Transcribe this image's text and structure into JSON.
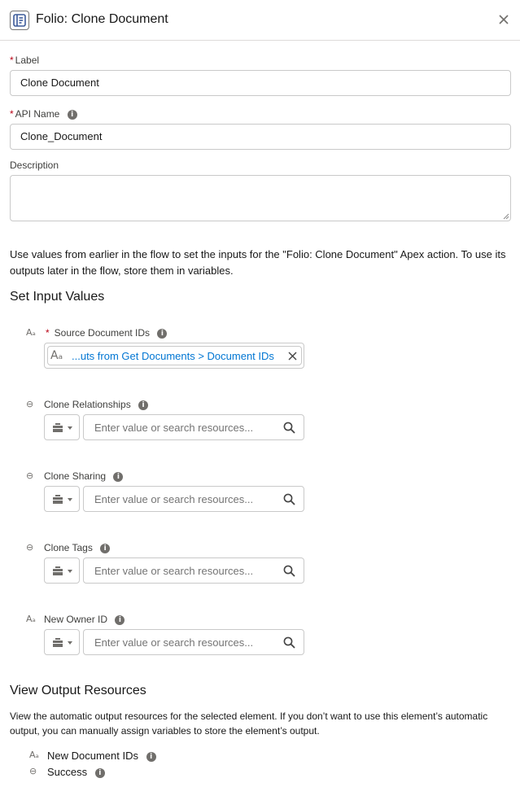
{
  "header": {
    "title": "Folio: Clone Document",
    "icon": "flow-action-icon",
    "close_icon": "close-icon"
  },
  "form": {
    "label": {
      "label": "Label",
      "required": "*",
      "value": "Clone Document"
    },
    "api_name": {
      "label": "API Name",
      "required": "*",
      "value": "Clone_Document"
    },
    "description": {
      "label": "Description",
      "value": ""
    }
  },
  "intro": "Use values from earlier in the flow to set the inputs for the \"Folio: Clone Document\" Apex action. To use its outputs later in the flow, store them in variables.",
  "inputs": {
    "title": "Set Input Values",
    "source_ids": {
      "type_glyph": "Aₐ",
      "required": "*",
      "label": "Source Document IDs",
      "pill_glyph": "Aₐ",
      "pill_text": "...uts from Get Documents > Document IDs"
    },
    "params": [
      {
        "type_glyph": "⊖",
        "label": "Clone Relationships",
        "placeholder": "Enter value or search resources..."
      },
      {
        "type_glyph": "⊖",
        "label": "Clone Sharing",
        "placeholder": "Enter value or search resources..."
      },
      {
        "type_glyph": "⊖",
        "label": "Clone Tags",
        "placeholder": "Enter value or search resources..."
      },
      {
        "type_glyph": "Aₐ",
        "label": "New Owner ID",
        "placeholder": "Enter value or search resources..."
      }
    ],
    "info_glyph": "i"
  },
  "outputs": {
    "title": "View Output Resources",
    "description": "View the automatic output resources for the selected element. If you don’t want to use this element’s automatic output, you can manually assign variables to store the element’s output.",
    "items": [
      {
        "type_glyph": "Aₐ",
        "label": "New Document IDs"
      },
      {
        "type_glyph": "⊖",
        "label": "Success"
      }
    ]
  },
  "colors": {
    "link": "#0176d3",
    "required": "#ba0517",
    "border": "#c9c9c9",
    "icon": "#706e6b"
  }
}
